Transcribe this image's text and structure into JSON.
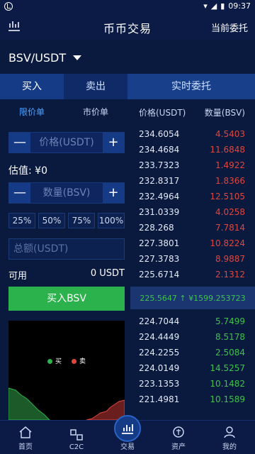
{
  "status": {
    "time": "09:37"
  },
  "header": {
    "title": "币币交易",
    "right_link": "当前委托"
  },
  "pair": "BSV/USDT",
  "tabs": {
    "buy": "买入",
    "sell": "卖出",
    "orders": "实时委托"
  },
  "subtabs": {
    "limit": "限价单",
    "market": "市价单"
  },
  "orderbook_header": {
    "price": "价格(USDT)",
    "amount": "数量(BSV)"
  },
  "form": {
    "price_placeholder": "价格(USDT)",
    "valuation": "估值: ¥0",
    "amount_placeholder": "数量(BSV)",
    "percents": [
      "25%",
      "50%",
      "75%",
      "100%"
    ],
    "total_placeholder": "总额(USDT)",
    "available_label": "可用",
    "available_value": "0 USDT",
    "buy_button": "买入BSV",
    "minus": "—",
    "plus": "+"
  },
  "depth_legend": {
    "buy": "买",
    "sell": "卖"
  },
  "asks": [
    {
      "price": "234.6054",
      "amount": "4.5403"
    },
    {
      "price": "234.4684",
      "amount": "11.6848"
    },
    {
      "price": "233.7323",
      "amount": "1.4922"
    },
    {
      "price": "232.8317",
      "amount": "1.8366"
    },
    {
      "price": "232.4964",
      "amount": "12.5105"
    },
    {
      "price": "231.0339",
      "amount": "4.0258"
    },
    {
      "price": "228.268",
      "amount": "7.7814"
    },
    {
      "price": "227.3801",
      "amount": "10.8224"
    },
    {
      "price": "227.3783",
      "amount": "8.9887"
    },
    {
      "price": "225.6714",
      "amount": "2.1312"
    }
  ],
  "mid_price": "225.5647 ↑ ¥1599.253723",
  "bids": [
    {
      "price": "224.7044",
      "amount": "5.7499"
    },
    {
      "price": "224.4449",
      "amount": "8.5178"
    },
    {
      "price": "224.2255",
      "amount": "2.5084"
    },
    {
      "price": "224.0149",
      "amount": "14.5257"
    },
    {
      "price": "223.1353",
      "amount": "10.1482"
    },
    {
      "price": "221.4981",
      "amount": "10.1589"
    }
  ],
  "nav": [
    {
      "label": "首页",
      "icon": "home-icon"
    },
    {
      "label": "C2C",
      "icon": "c2c-icon"
    },
    {
      "label": "交易",
      "icon": "trade-icon"
    },
    {
      "label": "资产",
      "icon": "assets-icon"
    },
    {
      "label": "我的",
      "icon": "profile-icon"
    }
  ],
  "colors": {
    "buy": "#2cb24c",
    "sell": "#e0463d",
    "accent": "#4fa3ff"
  }
}
